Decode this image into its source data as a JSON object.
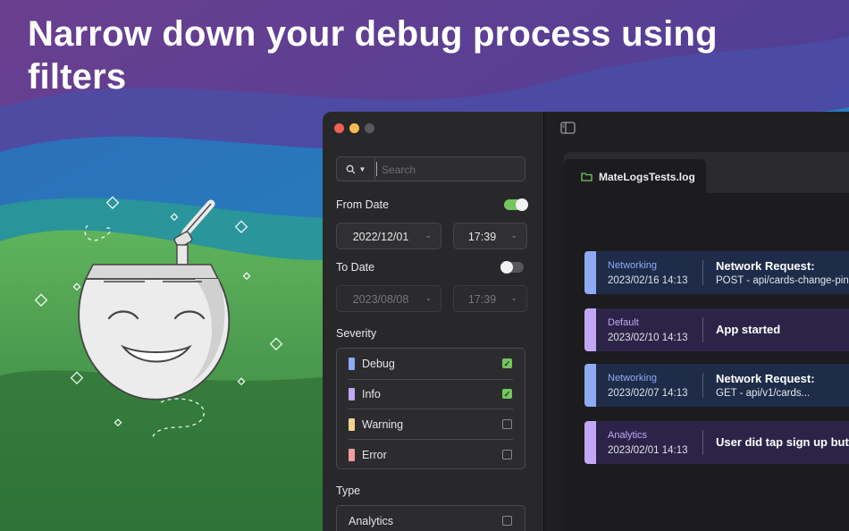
{
  "headline": "Narrow down your debug process using filters",
  "colors": {
    "accent_green": "#74c55f",
    "debug": "#8eaaf5",
    "info": "#c2a7f7",
    "warning": "#f3d28f",
    "error": "#f39a9a"
  },
  "sidebar": {
    "search": {
      "placeholder": "Search",
      "icon": "search-icon"
    },
    "from_date": {
      "label": "From Date",
      "enabled": true,
      "date": "2022/12/01",
      "time": "17:39"
    },
    "to_date": {
      "label": "To Date",
      "enabled": false,
      "date": "2023/08/08",
      "time": "17:39"
    },
    "severity": {
      "label": "Severity",
      "items": [
        {
          "label": "Debug",
          "checked": true
        },
        {
          "label": "Info",
          "checked": true
        },
        {
          "label": "Warning",
          "checked": false
        },
        {
          "label": "Error",
          "checked": false
        }
      ]
    },
    "type": {
      "label": "Type",
      "items": [
        {
          "label": "Analytics",
          "checked": false
        }
      ]
    }
  },
  "content": {
    "tab": {
      "name": "MateLogsTests.log"
    },
    "logs": [
      {
        "category": "Networking",
        "time": "2023/02/16 14:13",
        "title": "Network Request:",
        "detail": "POST - api/cards-change-pin"
      },
      {
        "category": "Default",
        "time": "2023/02/10 14:13",
        "title": "App started",
        "detail": ""
      },
      {
        "category": "Networking",
        "time": "2023/02/07 14:13",
        "title": "Network Request:",
        "detail": "GET - api/v1/cards..."
      },
      {
        "category": "Analytics",
        "time": "2023/02/01 14:13",
        "title": "User did tap sign up button",
        "detail": ""
      }
    ]
  }
}
